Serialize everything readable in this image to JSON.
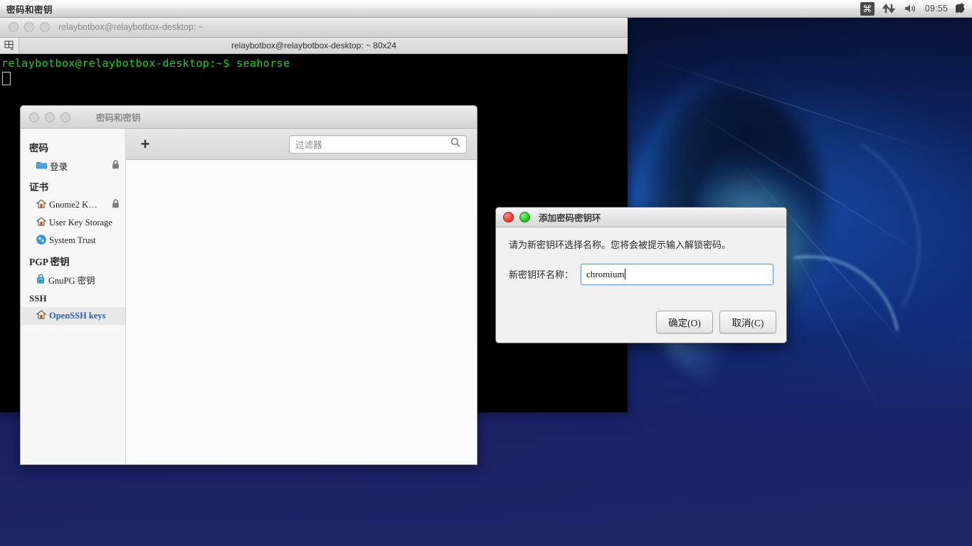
{
  "menubar": {
    "app_title": "密码和密钥",
    "cmd_icon": "command-icon",
    "network_icon": "network-updown-icon",
    "volume_icon": "volume-icon",
    "time": "09:55",
    "apple_icon": "apple-logo-icon"
  },
  "terminal": {
    "window_title": "relaybotbox@relaybotbox-desktop: ~",
    "tab_title": "relaybotbox@relaybotbox-desktop: ~ 80x24",
    "tab_list_icon": "tab-list-icon",
    "prompt_line": "relaybotbox@relaybotbox-desktop:~$ seahorse"
  },
  "seahorse": {
    "window_title": "密码和密钥",
    "toolbar": {
      "add_label": "+",
      "filter_placeholder": "过滤器",
      "search_icon": "search-icon"
    },
    "sidebar": {
      "groups": [
        {
          "title": "密码",
          "items": [
            {
              "label": "登录",
              "icon": "folder-icon",
              "locked": true,
              "selected": false
            }
          ]
        },
        {
          "title": "证书",
          "items": [
            {
              "label": "Gnome2 K…",
              "icon": "home-key-icon",
              "locked": true,
              "selected": false
            },
            {
              "label": "User Key Storage",
              "icon": "home-key-icon",
              "locked": false,
              "selected": false
            },
            {
              "label": "System Trust",
              "icon": "system-trust-icon",
              "locked": false,
              "selected": false
            }
          ]
        },
        {
          "title": "PGP 密钥",
          "items": [
            {
              "label": "GnuPG 密钥",
              "icon": "gnupg-key-icon",
              "locked": false,
              "selected": false
            }
          ]
        },
        {
          "title": "SSH",
          "items": [
            {
              "label": "OpenSSH keys",
              "icon": "home-key-icon",
              "locked": false,
              "selected": true
            }
          ]
        }
      ]
    }
  },
  "dialog": {
    "title": "添加密码密钥环",
    "close_icon": "close-traffic-light",
    "maximize_icon": "maximize-traffic-light",
    "message": "请为新密钥环选择名称。您将会被提示输入解锁密码。",
    "field_label": "新密钥环名称：",
    "field_value": "chromium",
    "ok_label": "确定(O)",
    "cancel_label": "取消(C)"
  },
  "colors": {
    "selection_text": "#2b62b0",
    "terminal_green": "#19d119",
    "focus_border": "#6e9ed4"
  }
}
